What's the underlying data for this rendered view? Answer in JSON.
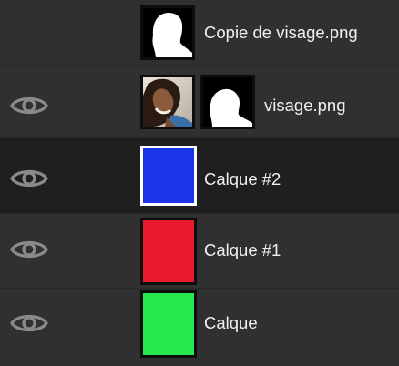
{
  "layers_panel": {
    "layers": [
      {
        "name": "Copie de visage.png",
        "visible": false,
        "thumbnail": "mask-silhouette"
      },
      {
        "name": "visage.png",
        "visible": true,
        "thumbnail": "photo-face",
        "mask": "mask-silhouette"
      },
      {
        "name": "Calque #2",
        "visible": true,
        "selected": true,
        "color": "#1a36e8"
      },
      {
        "name": "Calque #1",
        "visible": true,
        "color": "#e81a2c"
      },
      {
        "name": "Calque",
        "visible": true,
        "color": "#26e84c"
      }
    ]
  },
  "colors": {
    "background": "#303030",
    "selected_row": "#1f1f1f",
    "eye_icon": "#8a8a8a"
  }
}
